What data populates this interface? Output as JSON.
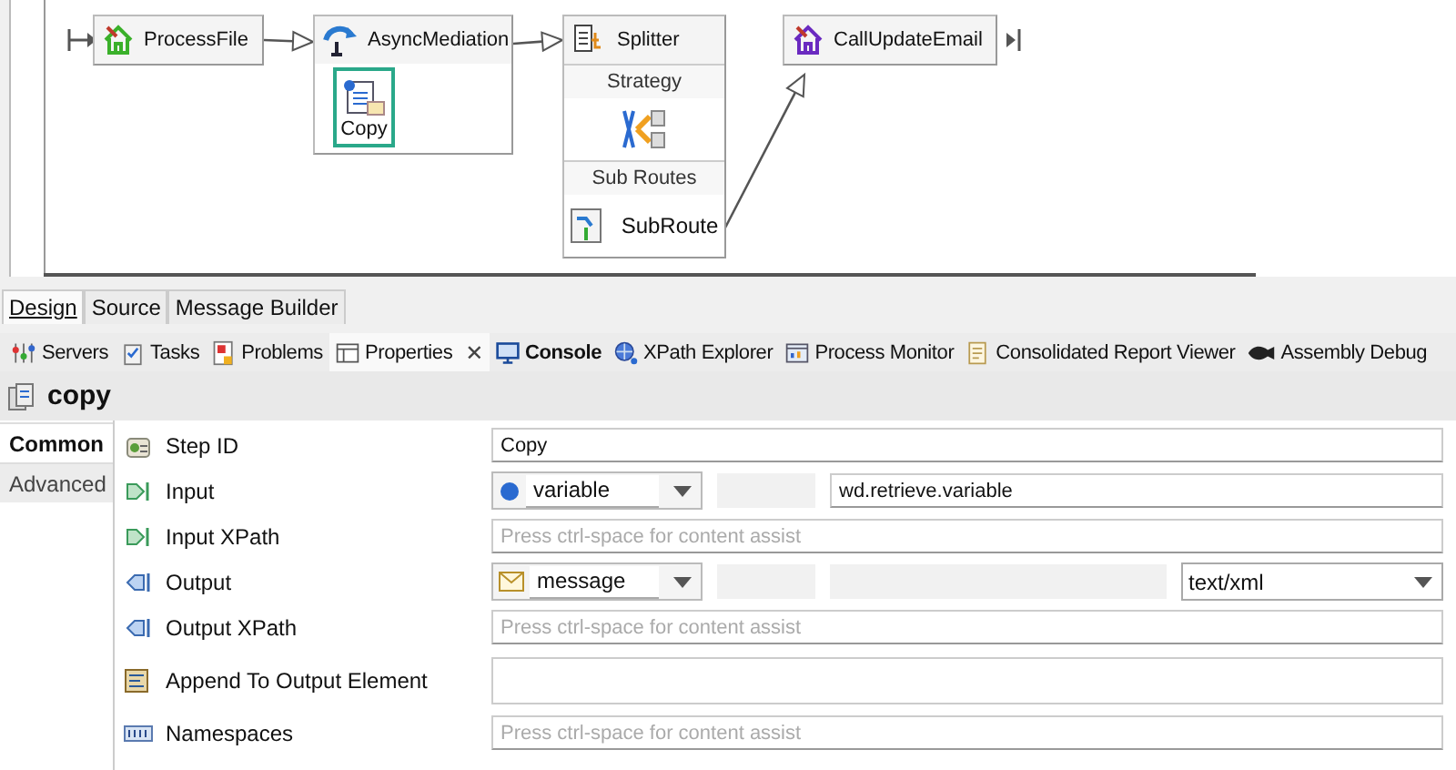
{
  "diagram": {
    "nodes": [
      {
        "kind": "step",
        "label": "ProcessFile"
      },
      {
        "kind": "container",
        "label": "AsyncMediation",
        "children": [
          {
            "label": "Copy",
            "selected": true
          }
        ]
      },
      {
        "kind": "splitter",
        "label": "Splitter",
        "sections": [
          {
            "title": "Strategy"
          },
          {
            "title": "Sub Routes",
            "items": [
              {
                "label": "SubRoute"
              }
            ]
          }
        ]
      },
      {
        "kind": "step",
        "label": "CallUpdateEmail"
      }
    ]
  },
  "editor_tabs": [
    {
      "label": "Design",
      "selected": true
    },
    {
      "label": "Source",
      "selected": false
    },
    {
      "label": "Message Builder",
      "selected": false
    }
  ],
  "view_tabs": [
    {
      "label": "Servers",
      "selected": false,
      "bold": false
    },
    {
      "label": "Tasks",
      "selected": false,
      "bold": false
    },
    {
      "label": "Problems",
      "selected": false,
      "bold": false
    },
    {
      "label": "Properties",
      "selected": true,
      "bold": false,
      "close": "✕"
    },
    {
      "label": "Console",
      "selected": false,
      "bold": true
    },
    {
      "label": "XPath Explorer",
      "selected": false,
      "bold": false
    },
    {
      "label": "Process Monitor",
      "selected": false,
      "bold": false
    },
    {
      "label": "Consolidated Report Viewer",
      "selected": false,
      "bold": false
    },
    {
      "label": "Assembly Debug",
      "selected": false,
      "bold": false
    }
  ],
  "properties": {
    "title": "copy",
    "side_tabs": [
      {
        "label": "Common",
        "selected": true
      },
      {
        "label": "Advanced",
        "selected": false
      }
    ],
    "rows": [
      {
        "kind": "text",
        "label": "Step ID",
        "value": "Copy"
      },
      {
        "kind": "source",
        "label": "Input",
        "source": {
          "kind": "variable",
          "label": "variable"
        },
        "value": "wd.retrieve.variable"
      },
      {
        "kind": "field",
        "label": "Input XPath",
        "placeholder": "Press ctrl-space for content assist"
      },
      {
        "kind": "source",
        "label": "Output",
        "source": {
          "kind": "message",
          "label": "message"
        },
        "content_type": "text/xml"
      },
      {
        "kind": "field",
        "label": "Output XPath",
        "placeholder": "Press ctrl-space for content assist"
      },
      {
        "kind": "area",
        "label": "Append To Output Element"
      },
      {
        "kind": "field",
        "label": "Namespaces",
        "placeholder": "Press ctrl-space for content assist"
      }
    ]
  }
}
